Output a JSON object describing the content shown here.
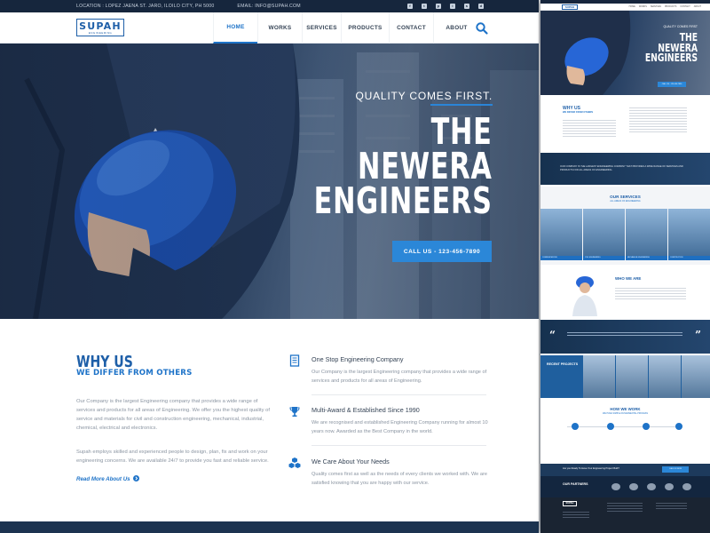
{
  "topbar": {
    "location": "LOCATION : LOPEZ JAENA ST. JARO, ILOILO CITY, PH 5000",
    "email": "EMAIL: INFO@SUPAH.COM",
    "social": [
      "f",
      "t",
      "p",
      "i",
      "s",
      "d"
    ]
  },
  "logo": {
    "word": "SUPAH",
    "sub": "ENGINEERING"
  },
  "nav": {
    "items": [
      "HOME",
      "WORKS",
      "SERVICES",
      "PRODUCTS",
      "CONTACT",
      "ABOUT"
    ],
    "active": "HOME",
    "search_icon": "search-icon"
  },
  "hero": {
    "tagline": "QUALITY COMES FIRST.",
    "title_line1": "THE",
    "title_line2": "NEWERA",
    "title_line3": "ENGINEERS",
    "cta": "CALL US - 123-456-7890"
  },
  "why": {
    "title": "WHY US",
    "subtitle": "WE DIFFER FROM OTHERS",
    "p1": "Our Company is the largest Engineering company that provides a wide range of services and products for all areas of Engineering. We offer you the highest quality of service and materials for civil and construction engineering, mechanical, industrial, chemical, electrical and electronics.",
    "p2": "Supah employs skilled and experienced people to design, plan, fix and work on your engineering concerns. We are available 24/7 to provide you fast and reliable service.",
    "read_more": "Read More About Us"
  },
  "features": [
    {
      "icon": "document-icon",
      "title": "One Stop Engineering Company",
      "desc": "Our Company is the largest Engineering company that provides a wide range of services and products for all areas of Engineering."
    },
    {
      "icon": "trophy-icon",
      "title": "Multi-Award & Established Since 1990",
      "desc": "We are recognised and established Engineering Company running for almost 10 years now. Awarded as the Best Company in the world."
    },
    {
      "icon": "cubes-icon",
      "title": "We Care About Your Needs",
      "desc": "Quality comes first as well as the needs of every clients we worked with. We are satisfied knowing that you are happy with our service."
    }
  ],
  "side": {
    "logo": "SUPAH",
    "nav": [
      "HOME",
      "WORKS",
      "SERVICES",
      "PRODUCTS",
      "CONTACT",
      "ABOUT"
    ],
    "hero_tag": "QUALITY COMES FIRST",
    "hero_l1": "THE",
    "hero_l2": "NEWERA",
    "hero_l3": "ENGINEERS",
    "hero_cta": "CALL US - 123-456-7890",
    "why_title": "WHY US",
    "why_sub": "WE DIFFER FROM OTHERS",
    "band_text": "OUR COMPANY IS THE LARGEST ENGINEERING COMPANY THAT PROVIDES A WIDE RANGE OF SERVICES AND PRODUCTS FOR ALL AREAS OF ENGINEERING.",
    "services_title": "OUR SERVICES",
    "services_sub": "ALL AREAS OF ENGINEERING",
    "service_tiles": [
      "COMMUNICATIONS",
      "CIVIL ENGINEERING",
      "MECHANICAL ENGINEERING",
      "CONSTRUCTION"
    ],
    "who_title": "WHO WE ARE",
    "projects_title": "RECENT PROJECTS",
    "work_title": "HOW WE WORK",
    "work_sub": "WE HAVE SIMPLE FUNDAMENTAL PROCESS",
    "ready_text": "Are you Ready To Have Your Engineering Project Built?",
    "ready_btn": "CALL US NOW",
    "partners_title": "OUR PARTNERS",
    "footer_logo": "SUPAH"
  },
  "colors": {
    "brand": "#1e5fa8",
    "accent": "#2b87d8",
    "dark": "#16263d"
  }
}
